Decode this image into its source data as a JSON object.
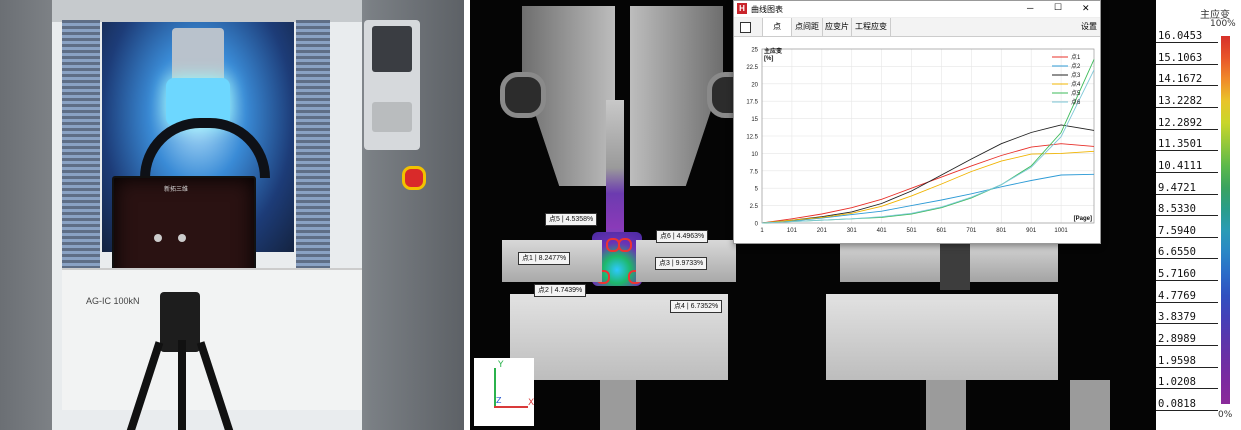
{
  "photo": {
    "machine_brand": "AG-IC 100kN",
    "camera_logo": "新拓三维"
  },
  "dic_labels": [
    {
      "text": "点5 | 4.5358%"
    },
    {
      "text": "点6 | 4.4963%"
    },
    {
      "text": "点1 | 8.2477%"
    },
    {
      "text": "点3 | 9.9733%"
    },
    {
      "text": "点2 | 4.7439%"
    },
    {
      "text": "点4 | 6.7352%"
    }
  ],
  "axes": {
    "y": "Y",
    "z": "Z",
    "x": "X"
  },
  "window": {
    "title": "曲线图表",
    "controls": {
      "min": "─",
      "max": "☐",
      "close": "✕"
    },
    "tabs": [
      "点",
      "点间距",
      "应变片",
      "工程应变"
    ],
    "settings": "设置",
    "save_icon": "save-icon"
  },
  "chart_data": {
    "type": "line",
    "ylabel": "主应变",
    "yunit": "[%]",
    "xunit": "[Page]",
    "ylim": [
      0,
      25
    ],
    "yticks": [
      "0",
      "2.5",
      "5",
      "7.5",
      "10",
      "12.5",
      "15",
      "17.5",
      "20",
      "22.5",
      "25"
    ],
    "xticks": [
      "1",
      "101",
      "201",
      "301",
      "401",
      "501",
      "601",
      "701",
      "801",
      "901",
      "1001"
    ],
    "xlim": [
      1,
      1111
    ],
    "series": [
      {
        "name": "点1",
        "color": "#e8302a",
        "x": [
          1,
          101,
          201,
          301,
          401,
          501,
          601,
          701,
          801,
          901,
          1001,
          1111
        ],
        "y": [
          0,
          0.6,
          1.3,
          2.2,
          3.4,
          5.0,
          6.6,
          8.2,
          9.7,
          10.9,
          11.4,
          11.0
        ]
      },
      {
        "name": "点2",
        "color": "#2e9bd6",
        "x": [
          1,
          101,
          201,
          301,
          401,
          501,
          601,
          701,
          801,
          901,
          1001,
          1111
        ],
        "y": [
          0,
          0.3,
          0.7,
          1.2,
          1.7,
          2.5,
          3.3,
          4.2,
          5.2,
          6.1,
          6.9,
          7.0
        ]
      },
      {
        "name": "点3",
        "color": "#222222",
        "x": [
          1,
          101,
          201,
          301,
          401,
          501,
          601,
          701,
          801,
          901,
          1001,
          1111
        ],
        "y": [
          0,
          0.4,
          0.9,
          1.6,
          2.8,
          4.6,
          6.9,
          9.2,
          11.4,
          13.0,
          14.1,
          13.3
        ]
      },
      {
        "name": "点4",
        "color": "#f0b400",
        "x": [
          1,
          101,
          201,
          301,
          401,
          501,
          601,
          701,
          801,
          901,
          1001,
          1111
        ],
        "y": [
          0,
          0.4,
          0.8,
          1.4,
          2.4,
          3.9,
          5.6,
          7.4,
          8.9,
          9.9,
          10.0,
          10.3
        ]
      },
      {
        "name": "点5",
        "color": "#3dbb5a",
        "x": [
          1,
          101,
          201,
          301,
          401,
          501,
          601,
          701,
          801,
          901,
          1001,
          1111
        ],
        "y": [
          0,
          0.2,
          0.4,
          0.6,
          0.8,
          1.3,
          2.2,
          3.6,
          5.5,
          8.2,
          13.0,
          23.5
        ]
      },
      {
        "name": "点6",
        "color": "#7ec8d8",
        "x": [
          1,
          101,
          201,
          301,
          401,
          501,
          601,
          701,
          801,
          901,
          1001,
          1111
        ],
        "y": [
          0,
          0.2,
          0.4,
          0.6,
          0.9,
          1.4,
          2.3,
          3.7,
          5.5,
          8.0,
          12.4,
          22.0
        ]
      }
    ]
  },
  "colorbar": {
    "title": "主应变",
    "top_pct": "100%",
    "bottom_pct": "0%",
    "values": [
      "16.0453",
      "15.1063",
      "14.1672",
      "13.2282",
      "12.2892",
      "11.3501",
      "10.4111",
      "9.4721",
      "8.5330",
      "7.5940",
      "6.6550",
      "5.7160",
      "4.7769",
      "3.8379",
      "2.8989",
      "1.9598",
      "1.0208",
      "0.0818"
    ],
    "colors": [
      "#d7312a",
      "#e8552a",
      "#f08a2a",
      "#e9c42a",
      "#c9d62a",
      "#93c83a",
      "#5cb94a",
      "#3aa35f",
      "#2a9d8a",
      "#2a9bb6",
      "#2a86c6",
      "#2b6bc8",
      "#3050c0",
      "#4440b8",
      "#5a36ac",
      "#6d2fa4",
      "#7d2a9f",
      "#8a2a9a"
    ]
  }
}
